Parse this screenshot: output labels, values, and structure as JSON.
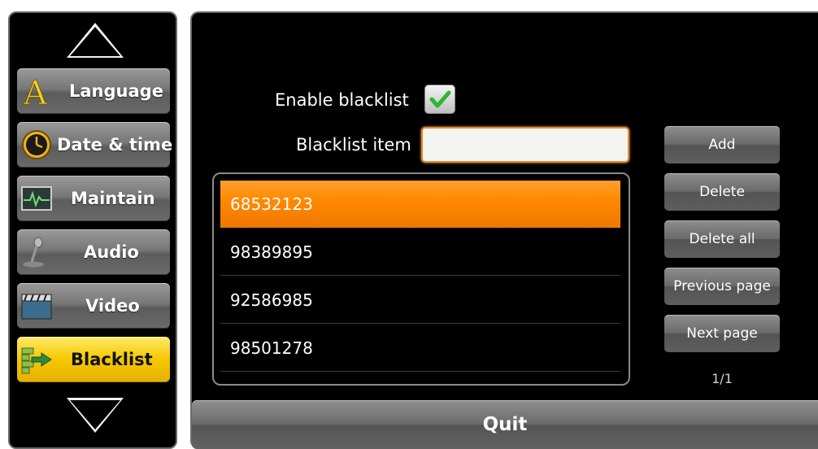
{
  "nav": {
    "items": [
      {
        "label": "Language",
        "icon": "letter-a-icon"
      },
      {
        "label": "Date & time",
        "icon": "clock-icon"
      },
      {
        "label": "Maintain",
        "icon": "heartbeat-monitor-icon"
      },
      {
        "label": "Audio",
        "icon": "microphone-icon"
      },
      {
        "label": "Video",
        "icon": "film-clapper-icon"
      },
      {
        "label": "Blacklist",
        "icon": "brick-wall-arrow-icon"
      }
    ],
    "active_index": 5,
    "scroll_up_icon": "triangle-up-icon",
    "scroll_down_icon": "triangle-down-icon"
  },
  "settings": {
    "enable_label": "Enable blacklist",
    "enable_checked": true,
    "item_label": "Blacklist item",
    "item_value": ""
  },
  "list": {
    "selected_index": 0,
    "entries": [
      "68532123",
      "98389895",
      "92586985",
      "98501278"
    ]
  },
  "buttons": {
    "add": "Add",
    "delete": "Delete",
    "delete_all": "Delete all",
    "previous_page": "Previous page",
    "next_page": "Next page",
    "quit": "Quit"
  },
  "pagination": {
    "indicator": "1/1"
  },
  "colors": {
    "selected_row": "#ff8a00",
    "active_nav": "#f5c800",
    "input_border": "#e48b2a",
    "checkmark": "#2fb52f"
  }
}
